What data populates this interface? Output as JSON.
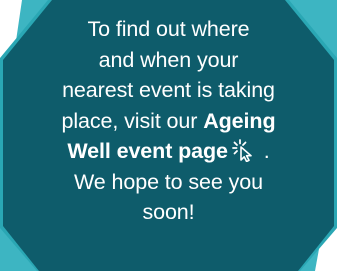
{
  "message": {
    "line1": "To find out where",
    "line2": "and when your",
    "line3": "nearest event is taking",
    "line4_prefix": "place, visit our ",
    "line4_bold": "Ageing",
    "line5_bold": "Well event page",
    "line5_suffix": " .",
    "line6": "We hope to see you",
    "line7": "soon!"
  },
  "icons": {
    "link": "cursor-click-icon"
  },
  "colors": {
    "panel": "#0e5c6b",
    "panel_edge": "#2aa7b4",
    "corner_accent": "#3db5c2",
    "text": "#ffffff"
  }
}
